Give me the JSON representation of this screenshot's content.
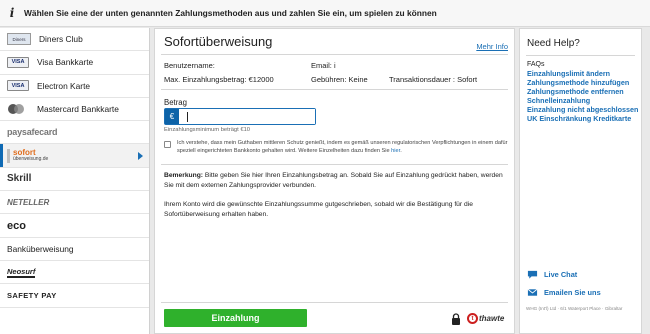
{
  "topbar": {
    "message": "Wählen Sie eine der unten genannten Zahlungsmethoden aus und zahlen Sie ein, um spielen zu können"
  },
  "sidebar": {
    "items": [
      {
        "label": "Diners Club",
        "logo": "diners-club-logo"
      },
      {
        "label": "Visa Bankkarte",
        "logo_text": "VISA"
      },
      {
        "label": "Electron Karte",
        "logo_text": "VISA"
      },
      {
        "label": "Mastercard Bankkarte",
        "logo": "mastercard-logo"
      },
      {
        "logo_text": "paysafecard"
      },
      {
        "logo_text_1": "sofort",
        "logo_text_2": "überweisung.de",
        "active": true
      },
      {
        "logo_text": "Skrill"
      },
      {
        "logo_text": "NETELLER"
      },
      {
        "logo_text": "eco"
      },
      {
        "label": "Banküberweisung"
      },
      {
        "logo_text": "Neosurf"
      },
      {
        "logo_text": "SAFETY PAY"
      }
    ]
  },
  "main": {
    "title": "Sofortüberweisung",
    "more_info": "Mehr Info",
    "username_label": "Benutzername:",
    "email_label": "Email:",
    "email_value": "i",
    "max_deposit": "Max. Einzahlungsbetrag: €12000",
    "fees": "Gebühren: Keine",
    "transaction_time": "Transaktionsdauer : Sofort",
    "amount_label": "Betrag",
    "currency_symbol": "€",
    "amount_value": "",
    "min_note": "Einzahlungsminimum beträgt €10",
    "consent_text": "Ich verstehe, dass mein Guthaben mittleren Schutz genießt, indem es gemäß unseren regulatorischen Verpflichtungen in einem dafür speziell eingerichteten Bankkonto gehalten wird. Weitere Einzelheiten dazu finden Sie",
    "consent_link": "hier",
    "remark_bold": "Bemerkung:",
    "remark_text": " Bitte geben Sie hier Ihren Einzahlungsbetrag an. Sobald Sie auf Einzahlung gedrückt haben, werden Sie mit dem externen Zahlungsprovider verbunden.",
    "remark2": "Ihrem Konto wird die gewünschte Einzahlungssumme gutgeschrieben, sobald wir die Bestätigung für die Sofortüberweisung erhalten haben.",
    "pay_button": "Einzahlung",
    "security_badge": "thawte"
  },
  "help": {
    "title": "Need Help?",
    "faq": "FAQs",
    "links": [
      "Einzahlungslimit ändern",
      "Zahlungsmethode hinzufügen",
      "Zahlungsmethode entfernen",
      "Schnelleinzahlung",
      "Einzahlung nicht abgeschlossen",
      "UK Einschränkung Kreditkarte"
    ],
    "live_chat": "Live Chat",
    "email_us": "Emailen Sie uns",
    "footer": "WHG (Int'l) Ltd · 6/1 Waterport Place · Gibraltar"
  },
  "colors": {
    "accent": "#1a6fb5",
    "pay_button": "#2fb12c",
    "currency_box": "#0d63a8"
  }
}
